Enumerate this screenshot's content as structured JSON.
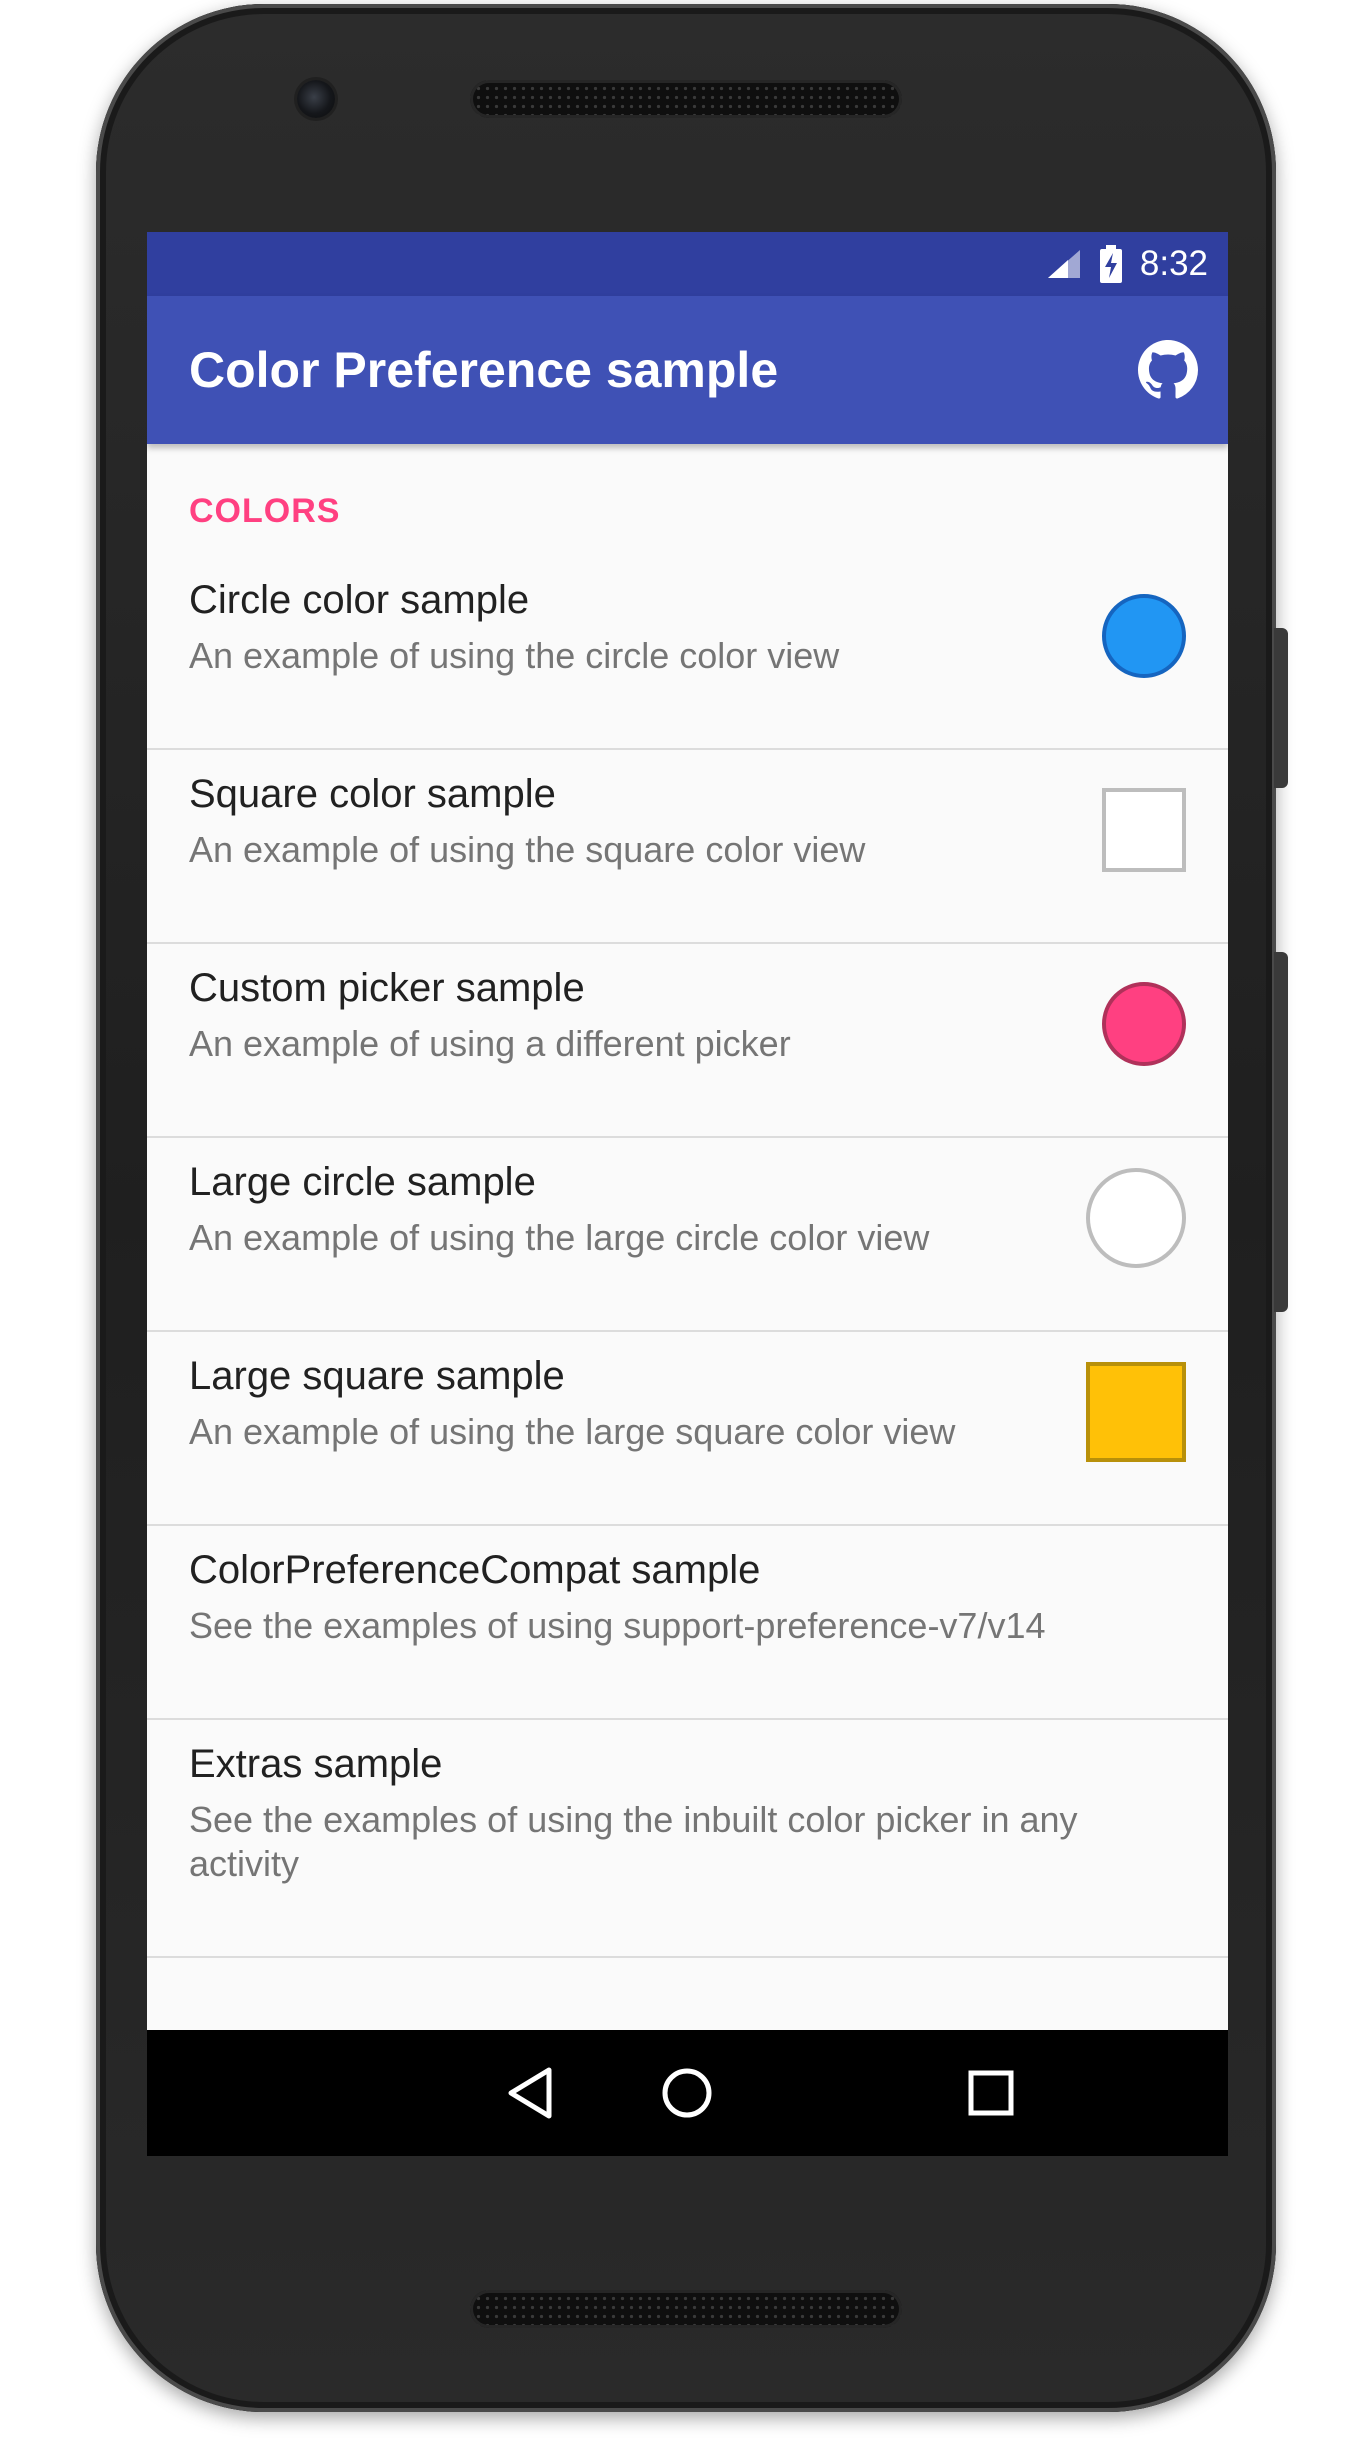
{
  "status_bar": {
    "time": "8:32",
    "icons": [
      "signal-icon",
      "battery-charging-icon"
    ]
  },
  "app_bar": {
    "title": "Color Preference sample",
    "action_icon": "github-icon",
    "background": "#3f51b5",
    "status_background": "#303f9f"
  },
  "preferences": {
    "category": "COLORS",
    "accent": "#ff4081",
    "items": [
      {
        "title": "Circle color sample",
        "summary": "An example of using the circle color view",
        "swatch": {
          "shape": "circle",
          "size": "small",
          "color": "#2196f3",
          "border": "#1565c0"
        }
      },
      {
        "title": "Square color sample",
        "summary": "An example of using the square color view",
        "swatch": {
          "shape": "square",
          "size": "small",
          "color": "#ffffff",
          "border": "#bdbdbd"
        }
      },
      {
        "title": "Custom picker sample",
        "summary": "An example of using a different picker",
        "swatch": {
          "shape": "circle",
          "size": "small",
          "color": "#ff4081",
          "border": "#b0315a"
        }
      },
      {
        "title": "Large circle sample",
        "summary": "An example of using the large circle color view",
        "swatch": {
          "shape": "circle",
          "size": "large",
          "color": "#ffffff",
          "border": "#bdbdbd"
        }
      },
      {
        "title": "Large square sample",
        "summary": "An example of using the large square color view",
        "swatch": {
          "shape": "square",
          "size": "large",
          "color": "#ffc107",
          "border": "#b8900a"
        }
      },
      {
        "title": "ColorPreferenceCompat sample",
        "summary": "See the examples of using support-preference-v7/v14"
      },
      {
        "title": "Extras sample",
        "summary": "See the examples of using the inbuilt color picker in any activity"
      }
    ]
  },
  "nav_bar": {
    "buttons": [
      "back-icon",
      "home-icon",
      "recents-icon"
    ]
  }
}
